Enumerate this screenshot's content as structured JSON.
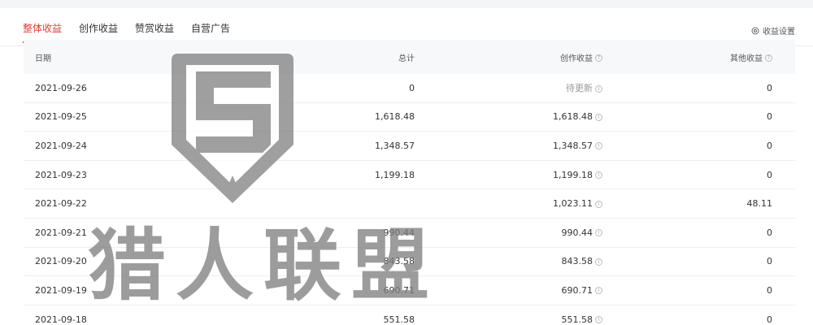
{
  "tabs": [
    {
      "label": "整体收益",
      "active": true
    },
    {
      "label": "创作收益",
      "active": false
    },
    {
      "label": "赞赏收益",
      "active": false
    },
    {
      "label": "自营广告",
      "active": false
    }
  ],
  "settings": {
    "label": "收益设置",
    "icon": "gear-icon"
  },
  "table": {
    "headers": {
      "date": "日期",
      "total": "总计",
      "creation": "创作收益",
      "other": "其他收益"
    },
    "rows": [
      {
        "date": "2021-09-26",
        "total": "0",
        "creation": "待更新",
        "other": "0"
      },
      {
        "date": "2021-09-25",
        "total": "1,618.48",
        "creation": "1,618.48",
        "other": "0"
      },
      {
        "date": "2021-09-24",
        "total": "1,348.57",
        "creation": "1,348.57",
        "other": "0"
      },
      {
        "date": "2021-09-23",
        "total": "1,199.18",
        "creation": "1,199.18",
        "other": "0"
      },
      {
        "date": "2021-09-22",
        "total": "",
        "creation": "1,023.11",
        "other": "48.11"
      },
      {
        "date": "2021-09-21",
        "total": "990.44",
        "creation": "990.44",
        "other": "0"
      },
      {
        "date": "2021-09-20",
        "total": "843.58",
        "creation": "843.58",
        "other": "0"
      },
      {
        "date": "2021-09-19",
        "total": "690.71",
        "creation": "690.71",
        "other": "0"
      },
      {
        "date": "2021-09-18",
        "total": "551.58",
        "creation": "551.58",
        "other": "0"
      }
    ]
  },
  "watermark": {
    "text": "猎人联盟"
  },
  "colors": {
    "accent": "#e33e33",
    "header_bg": "#f7f8fa",
    "watermark": "#808080"
  }
}
